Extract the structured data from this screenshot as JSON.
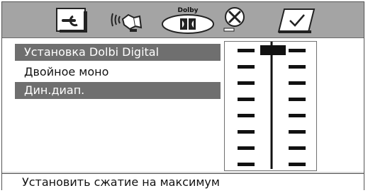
{
  "tabs": [
    {
      "name": "settings-tab",
      "icon": "wrench-icon"
    },
    {
      "name": "audio-tab",
      "icon": "speaker-waves-icon"
    },
    {
      "name": "dolby-tab",
      "icon": "dolby-digital-icon",
      "label": "Dolby"
    },
    {
      "name": "pref-tab",
      "icon": "disc-x-icon"
    },
    {
      "name": "confirm-tab",
      "icon": "checkmark-icon"
    }
  ],
  "menu": {
    "items": [
      {
        "label": "Установка Dolbi Digital",
        "highlighted": true
      },
      {
        "label": "Двойное моно",
        "highlighted": false
      },
      {
        "label": "Дин.диап.",
        "highlighted": true
      }
    ]
  },
  "level_slider": {
    "steps": 8,
    "selected_step_from_top": 1
  },
  "status": {
    "text": "Установить сжатие на максимум"
  },
  "colors": {
    "tabbar": "#a4a4a4",
    "highlight": "#6f6f6f",
    "panel_bg": "#d9d9d9"
  }
}
